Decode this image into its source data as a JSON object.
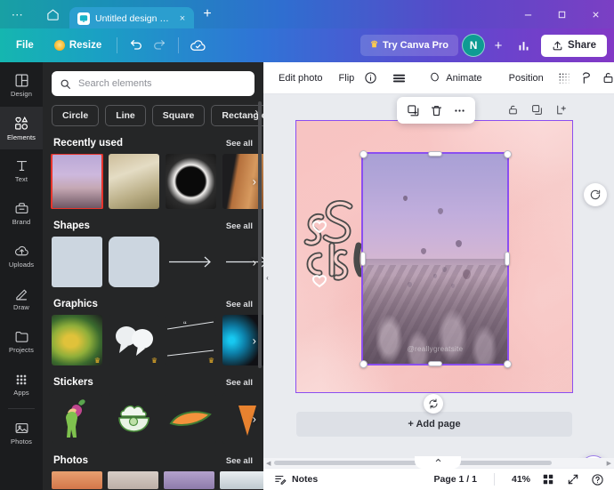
{
  "browser": {
    "menu_icon": "more-horizontal-icon",
    "home_icon": "home-icon",
    "tab": {
      "title": "Untitled design - In...",
      "favicon": "canva-favicon",
      "close": "×"
    },
    "new_tab": "+",
    "window": {
      "minimize": "—",
      "maximize": "❑",
      "close": "×"
    }
  },
  "topbar": {
    "file": "File",
    "resize": "Resize",
    "undo_icon": "undo-icon",
    "redo_icon": "redo-icon",
    "cloud_icon": "cloud-saved-icon",
    "try_pro": "Try Canva Pro",
    "avatar_initial": "N",
    "add_member": "+",
    "insights_icon": "insights-icon",
    "share": "Share",
    "accent_teal": "#15b6b0",
    "accent_purple": "#8238c6"
  },
  "rail": {
    "items": [
      {
        "label": "Design",
        "icon": "design-icon",
        "active": false
      },
      {
        "label": "Elements",
        "icon": "elements-icon",
        "active": true
      },
      {
        "label": "Text",
        "icon": "text-icon",
        "active": false
      },
      {
        "label": "Brand",
        "icon": "brand-icon",
        "active": false
      },
      {
        "label": "Uploads",
        "icon": "uploads-icon",
        "active": false
      },
      {
        "label": "Draw",
        "icon": "draw-icon",
        "active": false
      },
      {
        "label": "Projects",
        "icon": "projects-icon",
        "active": false
      },
      {
        "label": "Apps",
        "icon": "apps-icon",
        "active": false
      },
      {
        "label": "Photos",
        "icon": "photos-icon",
        "active": false
      }
    ]
  },
  "panel": {
    "search": {
      "placeholder": "Search elements",
      "value": "",
      "icon": "search-icon"
    },
    "chips": [
      "Circle",
      "Line",
      "Square",
      "Rectangle"
    ],
    "sections": [
      {
        "title": "Recently used",
        "see_all": "See all"
      },
      {
        "title": "Shapes",
        "see_all": "See all"
      },
      {
        "title": "Graphics",
        "see_all": "See all"
      },
      {
        "title": "Stickers",
        "see_all": "See all"
      },
      {
        "title": "Photos",
        "see_all": "See all"
      }
    ],
    "next_arrow": "›",
    "collapse_arrow": "‹"
  },
  "object_toolbar": {
    "edit_photo": "Edit photo",
    "flip": "Flip",
    "info_icon": "info-icon",
    "lines_icon": "adjust-lines-icon",
    "animate": "Animate",
    "animate_icon": "animate-icon",
    "position": "Position",
    "transparency_icon": "transparency-icon",
    "tone_icon": "tone-icon",
    "lock_icon": "lock-icon"
  },
  "canvas": {
    "page_icons": [
      "lock-icon",
      "duplicate-page-icon",
      "add-page-icon"
    ],
    "float_toolbar": [
      "duplicate-icon",
      "trash-icon",
      "more-icon"
    ],
    "rotate_icon": "rotate-icon",
    "magic_icon": "magic-sparkle-icon",
    "side_refresh_icon": "regenerate-icon",
    "watermark": "@reallygreatsite",
    "add_page": "+ Add page",
    "selection_color": "#8b4ef0",
    "page_bg": "#fbd9d6"
  },
  "statusbar": {
    "notes": "Notes",
    "notes_icon": "notes-icon",
    "page_indicator": "Page 1 / 1",
    "zoom": "41%",
    "grid_icon": "grid-view-icon",
    "fullscreen_icon": "fullscreen-icon",
    "help_icon": "help-icon",
    "collapse_icon": "chevron-up-icon"
  }
}
